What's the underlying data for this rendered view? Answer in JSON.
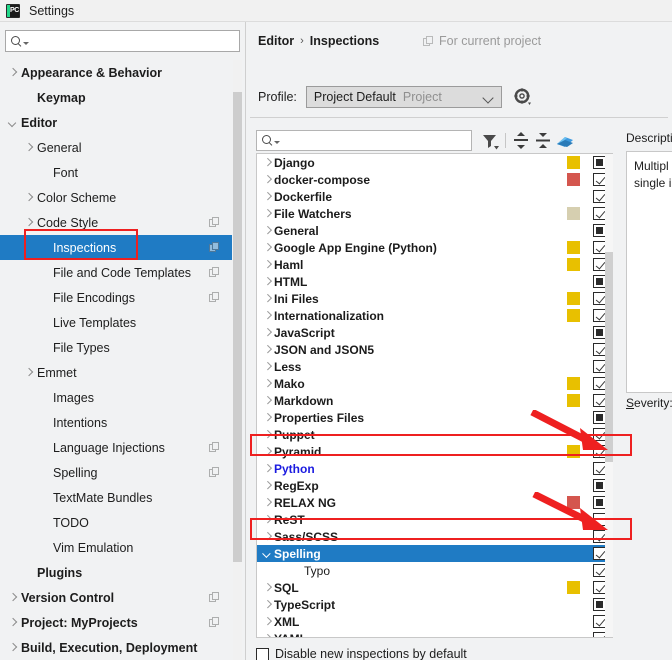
{
  "window": {
    "title": "Settings",
    "logo_icon": "pycharm-logo-icon"
  },
  "sidebar": {
    "search": {
      "value": "",
      "placeholder": "",
      "icon": "search-icon"
    },
    "items": [
      {
        "label": "Appearance & Behavior",
        "bold": true,
        "indent": 6,
        "arrow": "closed",
        "copy": false,
        "selected": false
      },
      {
        "label": "Keymap",
        "bold": true,
        "indent": 22,
        "arrow": "none",
        "copy": false,
        "selected": false
      },
      {
        "label": "Editor",
        "bold": true,
        "indent": 6,
        "arrow": "open",
        "copy": false,
        "selected": false
      },
      {
        "label": "General",
        "bold": false,
        "indent": 22,
        "arrow": "closed",
        "copy": false,
        "selected": false
      },
      {
        "label": "Font",
        "bold": false,
        "indent": 38,
        "arrow": "none",
        "copy": false,
        "selected": false
      },
      {
        "label": "Color Scheme",
        "bold": false,
        "indent": 22,
        "arrow": "closed",
        "copy": false,
        "selected": false
      },
      {
        "label": "Code Style",
        "bold": false,
        "indent": 22,
        "arrow": "closed",
        "copy": true,
        "selected": false
      },
      {
        "label": "Inspections",
        "bold": false,
        "indent": 38,
        "arrow": "none",
        "copy": true,
        "selected": true
      },
      {
        "label": "File and Code Templates",
        "bold": false,
        "indent": 38,
        "arrow": "none",
        "copy": true,
        "selected": false
      },
      {
        "label": "File Encodings",
        "bold": false,
        "indent": 38,
        "arrow": "none",
        "copy": true,
        "selected": false
      },
      {
        "label": "Live Templates",
        "bold": false,
        "indent": 38,
        "arrow": "none",
        "copy": false,
        "selected": false
      },
      {
        "label": "File Types",
        "bold": false,
        "indent": 38,
        "arrow": "none",
        "copy": false,
        "selected": false
      },
      {
        "label": "Emmet",
        "bold": false,
        "indent": 22,
        "arrow": "closed",
        "copy": false,
        "selected": false
      },
      {
        "label": "Images",
        "bold": false,
        "indent": 38,
        "arrow": "none",
        "copy": false,
        "selected": false
      },
      {
        "label": "Intentions",
        "bold": false,
        "indent": 38,
        "arrow": "none",
        "copy": false,
        "selected": false
      },
      {
        "label": "Language Injections",
        "bold": false,
        "indent": 38,
        "arrow": "none",
        "copy": true,
        "selected": false
      },
      {
        "label": "Spelling",
        "bold": false,
        "indent": 38,
        "arrow": "none",
        "copy": true,
        "selected": false
      },
      {
        "label": "TextMate Bundles",
        "bold": false,
        "indent": 38,
        "arrow": "none",
        "copy": false,
        "selected": false
      },
      {
        "label": "TODO",
        "bold": false,
        "indent": 38,
        "arrow": "none",
        "copy": false,
        "selected": false
      },
      {
        "label": "Vim Emulation",
        "bold": false,
        "indent": 38,
        "arrow": "none",
        "copy": false,
        "selected": false
      },
      {
        "label": "Plugins",
        "bold": true,
        "indent": 22,
        "arrow": "none",
        "copy": false,
        "selected": false
      },
      {
        "label": "Version Control",
        "bold": true,
        "indent": 6,
        "arrow": "closed",
        "copy": true,
        "selected": false
      },
      {
        "label": "Project: MyProjects",
        "bold": true,
        "indent": 6,
        "arrow": "closed",
        "copy": true,
        "selected": false
      },
      {
        "label": "Build, Execution, Deployment",
        "bold": true,
        "indent": 6,
        "arrow": "closed",
        "copy": false,
        "selected": false
      }
    ]
  },
  "header": {
    "breadcrumb": {
      "parent": "Editor",
      "separator": "›",
      "current": "Inspections"
    },
    "for_current_project": {
      "label": "For current project",
      "icon": "copy-icon"
    },
    "profile": {
      "label": "Profile:",
      "value": "Project Default",
      "scope": "Project",
      "chevron_icon": "chevron-down-icon",
      "gear_icon": "gear-icon"
    }
  },
  "toolbar": {
    "search": {
      "value": "",
      "placeholder": "",
      "icon": "search-icon"
    },
    "buttons": [
      {
        "name": "filter-icon",
        "title": "Filter"
      },
      {
        "name": "expand-all-icon",
        "title": "Expand All"
      },
      {
        "name": "collapse-all-icon",
        "title": "Collapse All"
      },
      {
        "name": "reset-eraser-icon",
        "title": "Reset"
      }
    ]
  },
  "inspections": {
    "rows": [
      {
        "label": "Django",
        "arrow": "closed",
        "indent": 0,
        "swatch": "#E8C000",
        "check": "partial",
        "selected": false,
        "blue": false,
        "bold": true
      },
      {
        "label": "docker-compose",
        "arrow": "closed",
        "indent": 0,
        "swatch": "#D4564E",
        "check": "checked",
        "selected": false,
        "blue": false,
        "bold": true
      },
      {
        "label": "Dockerfile",
        "arrow": "closed",
        "indent": 0,
        "swatch": null,
        "check": "checked",
        "selected": false,
        "blue": false,
        "bold": true
      },
      {
        "label": "File Watchers",
        "arrow": "closed",
        "indent": 0,
        "swatch": "#D6CFB0",
        "check": "checked",
        "selected": false,
        "blue": false,
        "bold": true
      },
      {
        "label": "General",
        "arrow": "closed",
        "indent": 0,
        "swatch": null,
        "check": "partial",
        "selected": false,
        "blue": false,
        "bold": true
      },
      {
        "label": "Google App Engine (Python)",
        "arrow": "closed",
        "indent": 0,
        "swatch": "#E8C000",
        "check": "checked",
        "selected": false,
        "blue": false,
        "bold": true
      },
      {
        "label": "Haml",
        "arrow": "closed",
        "indent": 0,
        "swatch": "#E8C000",
        "check": "checked",
        "selected": false,
        "blue": false,
        "bold": true
      },
      {
        "label": "HTML",
        "arrow": "closed",
        "indent": 0,
        "swatch": null,
        "check": "partial",
        "selected": false,
        "blue": false,
        "bold": true
      },
      {
        "label": "Ini Files",
        "arrow": "closed",
        "indent": 0,
        "swatch": "#E8C000",
        "check": "checked",
        "selected": false,
        "blue": false,
        "bold": true
      },
      {
        "label": "Internationalization",
        "arrow": "closed",
        "indent": 0,
        "swatch": "#E8C000",
        "check": "checked",
        "selected": false,
        "blue": false,
        "bold": true
      },
      {
        "label": "JavaScript",
        "arrow": "closed",
        "indent": 0,
        "swatch": null,
        "check": "partial",
        "selected": false,
        "blue": false,
        "bold": true
      },
      {
        "label": "JSON and JSON5",
        "arrow": "closed",
        "indent": 0,
        "swatch": null,
        "check": "checked",
        "selected": false,
        "blue": false,
        "bold": true
      },
      {
        "label": "Less",
        "arrow": "closed",
        "indent": 0,
        "swatch": null,
        "check": "checked",
        "selected": false,
        "blue": false,
        "bold": true
      },
      {
        "label": "Mako",
        "arrow": "closed",
        "indent": 0,
        "swatch": "#E8C000",
        "check": "checked",
        "selected": false,
        "blue": false,
        "bold": true
      },
      {
        "label": "Markdown",
        "arrow": "closed",
        "indent": 0,
        "swatch": "#E8C000",
        "check": "checked",
        "selected": false,
        "blue": false,
        "bold": true
      },
      {
        "label": "Properties Files",
        "arrow": "closed",
        "indent": 0,
        "swatch": null,
        "check": "partial",
        "selected": false,
        "blue": false,
        "bold": true
      },
      {
        "label": "Puppet",
        "arrow": "closed",
        "indent": 0,
        "swatch": null,
        "check": "checked",
        "selected": false,
        "blue": false,
        "bold": true
      },
      {
        "label": "Pyramid",
        "arrow": "closed",
        "indent": 0,
        "swatch": "#E8C000",
        "check": "checked",
        "selected": false,
        "blue": false,
        "bold": true
      },
      {
        "label": "Python",
        "arrow": "closed",
        "indent": 0,
        "swatch": null,
        "check": "checked",
        "selected": false,
        "blue": true,
        "bold": true
      },
      {
        "label": "RegExp",
        "arrow": "closed",
        "indent": 0,
        "swatch": null,
        "check": "partial",
        "selected": false,
        "blue": false,
        "bold": true
      },
      {
        "label": "RELAX NG",
        "arrow": "closed",
        "indent": 0,
        "swatch": "#D4564E",
        "check": "partial",
        "selected": false,
        "blue": false,
        "bold": true
      },
      {
        "label": "ReST",
        "arrow": "closed",
        "indent": 0,
        "swatch": null,
        "check": "unchecked",
        "selected": false,
        "blue": false,
        "bold": true
      },
      {
        "label": "Sass/SCSS",
        "arrow": "closed",
        "indent": 0,
        "swatch": null,
        "check": "checked",
        "selected": false,
        "blue": false,
        "bold": true
      },
      {
        "label": "Spelling",
        "arrow": "open",
        "indent": 0,
        "swatch": null,
        "check": "checked",
        "selected": true,
        "blue": false,
        "bold": true
      },
      {
        "label": "Typo",
        "arrow": "none",
        "indent": 30,
        "swatch": null,
        "check": "checked",
        "selected": false,
        "blue": false,
        "bold": false
      },
      {
        "label": "SQL",
        "arrow": "closed",
        "indent": 0,
        "swatch": "#E8C000",
        "check": "checked",
        "selected": false,
        "blue": false,
        "bold": true
      },
      {
        "label": "TypeScript",
        "arrow": "closed",
        "indent": 0,
        "swatch": null,
        "check": "partial",
        "selected": false,
        "blue": false,
        "bold": true
      },
      {
        "label": "XML",
        "arrow": "closed",
        "indent": 0,
        "swatch": null,
        "check": "checked",
        "selected": false,
        "blue": false,
        "bold": true
      },
      {
        "label": "YAML",
        "arrow": "closed",
        "indent": 0,
        "swatch": null,
        "check": "checked",
        "selected": false,
        "blue": false,
        "bold": true
      }
    ],
    "disable_new": {
      "label": "Disable new inspections by default",
      "checked": false
    }
  },
  "description": {
    "label": "Description",
    "lines": [
      "Multipl",
      "single i"
    ],
    "severity_label": "Severity:"
  },
  "annotations": {
    "accent_color": "#ee2020",
    "boxes": [
      "sidebar-inspections",
      "row-python",
      "row-spelling"
    ],
    "arrows": [
      "arrow-to-python-checkbox",
      "arrow-to-spelling-checkbox"
    ]
  }
}
